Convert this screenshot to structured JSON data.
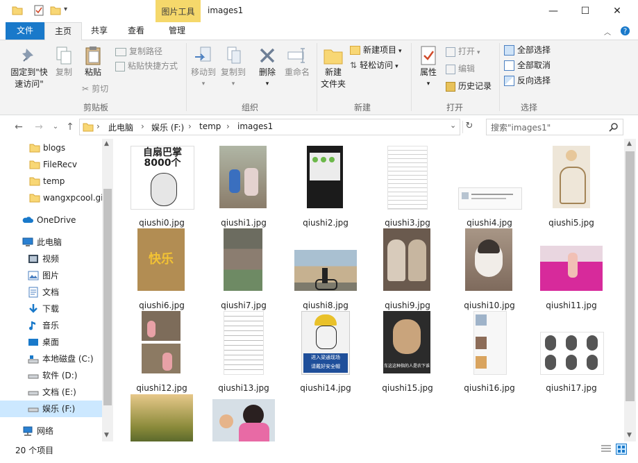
{
  "window": {
    "title": "images1",
    "context_tab_group": "图片工具"
  },
  "tabs": [
    {
      "label": "文件"
    },
    {
      "label": "主页"
    },
    {
      "label": "共享"
    },
    {
      "label": "查看"
    },
    {
      "label": "管理"
    }
  ],
  "ribbon": {
    "clipboard": {
      "group_label": "剪贴板",
      "pin_label": "固定到\"快速访问\"",
      "copy_label": "复制",
      "paste_label": "粘贴",
      "copy_path_label": "复制路径",
      "paste_shortcut_label": "粘贴快捷方式",
      "cut_label": "剪切"
    },
    "organize": {
      "group_label": "组织",
      "move_to_label": "移动到",
      "copy_to_label": "复制到",
      "delete_label": "删除",
      "rename_label": "重命名"
    },
    "new": {
      "group_label": "新建",
      "new_folder_label": "新建\n文件夹",
      "new_item_label": "新建项目",
      "easy_access_label": "轻松访问"
    },
    "open": {
      "group_label": "打开",
      "properties_label": "属性",
      "open_label": "打开",
      "edit_label": "编辑",
      "history_label": "历史记录"
    },
    "select": {
      "group_label": "选择",
      "select_all_label": "全部选择",
      "select_none_label": "全部取消",
      "invert_label": "反向选择"
    }
  },
  "address": {
    "breadcrumb": [
      "此电脑",
      "娱乐 (F:)",
      "temp",
      "images1"
    ],
    "search_placeholder": "搜索\"images1\""
  },
  "nav": {
    "folders": [
      "blogs",
      "FileRecv",
      "temp",
      "wangxpcool.gi"
    ],
    "onedrive": "OneDrive",
    "this_pc": "此电脑",
    "pc_items": [
      "视频",
      "图片",
      "文档",
      "下载",
      "音乐",
      "桌面",
      "本地磁盘 (C:)",
      "软件 (D:)",
      "文档 (E:)",
      "娱乐 (F:)"
    ],
    "network": "网络"
  },
  "files": [
    "qiushi0.jpg",
    "qiushi1.jpg",
    "qiushi2.jpg",
    "qiushi3.jpg",
    "qiushi4.jpg",
    "qiushi5.jpg",
    "qiushi6.jpg",
    "qiushi7.jpg",
    "qiushi8.jpg",
    "qiushi9.jpg",
    "qiushi10.jpg",
    "qiushi11.jpg",
    "qiushi12.jpg",
    "qiushi13.jpg",
    "qiushi14.jpg",
    "qiushi15.jpg",
    "qiushi16.jpg",
    "qiushi17.jpg",
    "",
    ""
  ],
  "thumb_text": {
    "t0": "自扇巴掌\n8000个",
    "t6": "快乐",
    "t14": "进入梁通现场\n请戴好安全帽",
    "t15": "车这这种指的人是农下谁"
  },
  "status": {
    "count": "20 个项目"
  },
  "colors": {
    "accent": "#1979ca",
    "context_tab": "#f5d86b",
    "selection": "#cce8ff",
    "folder": "#f8d775"
  }
}
